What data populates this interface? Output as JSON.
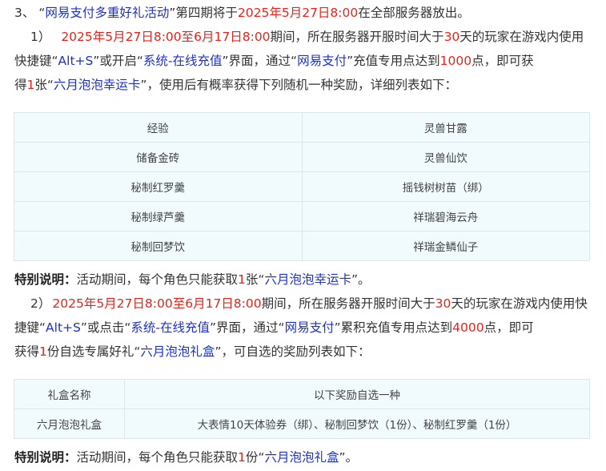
{
  "para3": {
    "num": "3、",
    "q_open": "“",
    "event": "网易支付多重好礼活动",
    "q_close": "”",
    "mid": "第四期将于",
    "date": "2025年5月27日8:00",
    "tail": "在全部服务器放出。"
  },
  "item1": {
    "num": "1）",
    "period": "2025年5月27日8:00至6月17日8:00",
    "t1": "期间，所在服务器开服时间大于",
    "days": "30",
    "t2": "天的玩家在游戏内使用",
    "t3": "快捷键“",
    "hotkey": "Alt+S",
    "t4": "”或开启“",
    "menu": "系统-在线充值",
    "t5": "”界面，通过“",
    "pay": "网易支付",
    "t6": "”充值专用点达到",
    "points": "1000",
    "t7": "点，即可获",
    "t8": "得",
    "count": "1",
    "t9": "张“",
    "card": "六月泡泡幸运卡",
    "t10": "”，使用后有概率获得下列随机一种奖励，详细列表如下："
  },
  "table1": {
    "rows": [
      [
        "经验",
        "灵兽甘露"
      ],
      [
        "储备金砖",
        "灵兽仙饮"
      ],
      [
        "秘制红罗羹",
        "摇钱树树苗（绑）"
      ],
      [
        "秘制绿芦羹",
        "祥瑞碧海云舟"
      ],
      [
        "秘制回梦饮",
        "祥瑞金鳞仙子"
      ]
    ]
  },
  "note1": {
    "label": "特别说明：",
    "t1": "活动期间，每个角色只能获取",
    "count": "1",
    "t2": "张“",
    "item": "六月泡泡幸运卡",
    "t3": "”。"
  },
  "item2": {
    "num": "2）",
    "period": "2025年5月27日8:00至6月17日8:00",
    "t1": "期间，所在服务器开服时间大于",
    "days": "30",
    "t2": "天的玩家在游戏内使用快",
    "t3": "捷键“",
    "hotkey": "Alt+S",
    "t4": "”或点击“",
    "menu": "系统-在线充值",
    "t5": "”界面，通过“",
    "pay": "网易支付",
    "t6": "”累积充值专用点达到",
    "points": "4000",
    "t7": "点，即可",
    "t8": "获得",
    "count": "1",
    "t9": "份自选专属好礼“",
    "box": "六月泡泡礼盒",
    "t10": "”，可自选的奖励列表如下："
  },
  "table2": {
    "header": [
      "礼盒名称",
      "以下奖励自选一种"
    ],
    "row": [
      "六月泡泡礼盒",
      "大表情10天体验券（绑）、秘制回梦饮（1份）、秘制红罗羹（1份）"
    ]
  },
  "note2": {
    "label": "特别说明：",
    "t1": "活动期间，每个角色只能获取",
    "count": "1",
    "t2": "份“",
    "item": "六月泡泡礼盒",
    "t3": "”。"
  },
  "colors": {
    "red": "#e8231d",
    "blue": "#1f32c8",
    "text": "#333333",
    "table_bg": "#f1fbfe",
    "table_border": "#dbe7ec"
  }
}
